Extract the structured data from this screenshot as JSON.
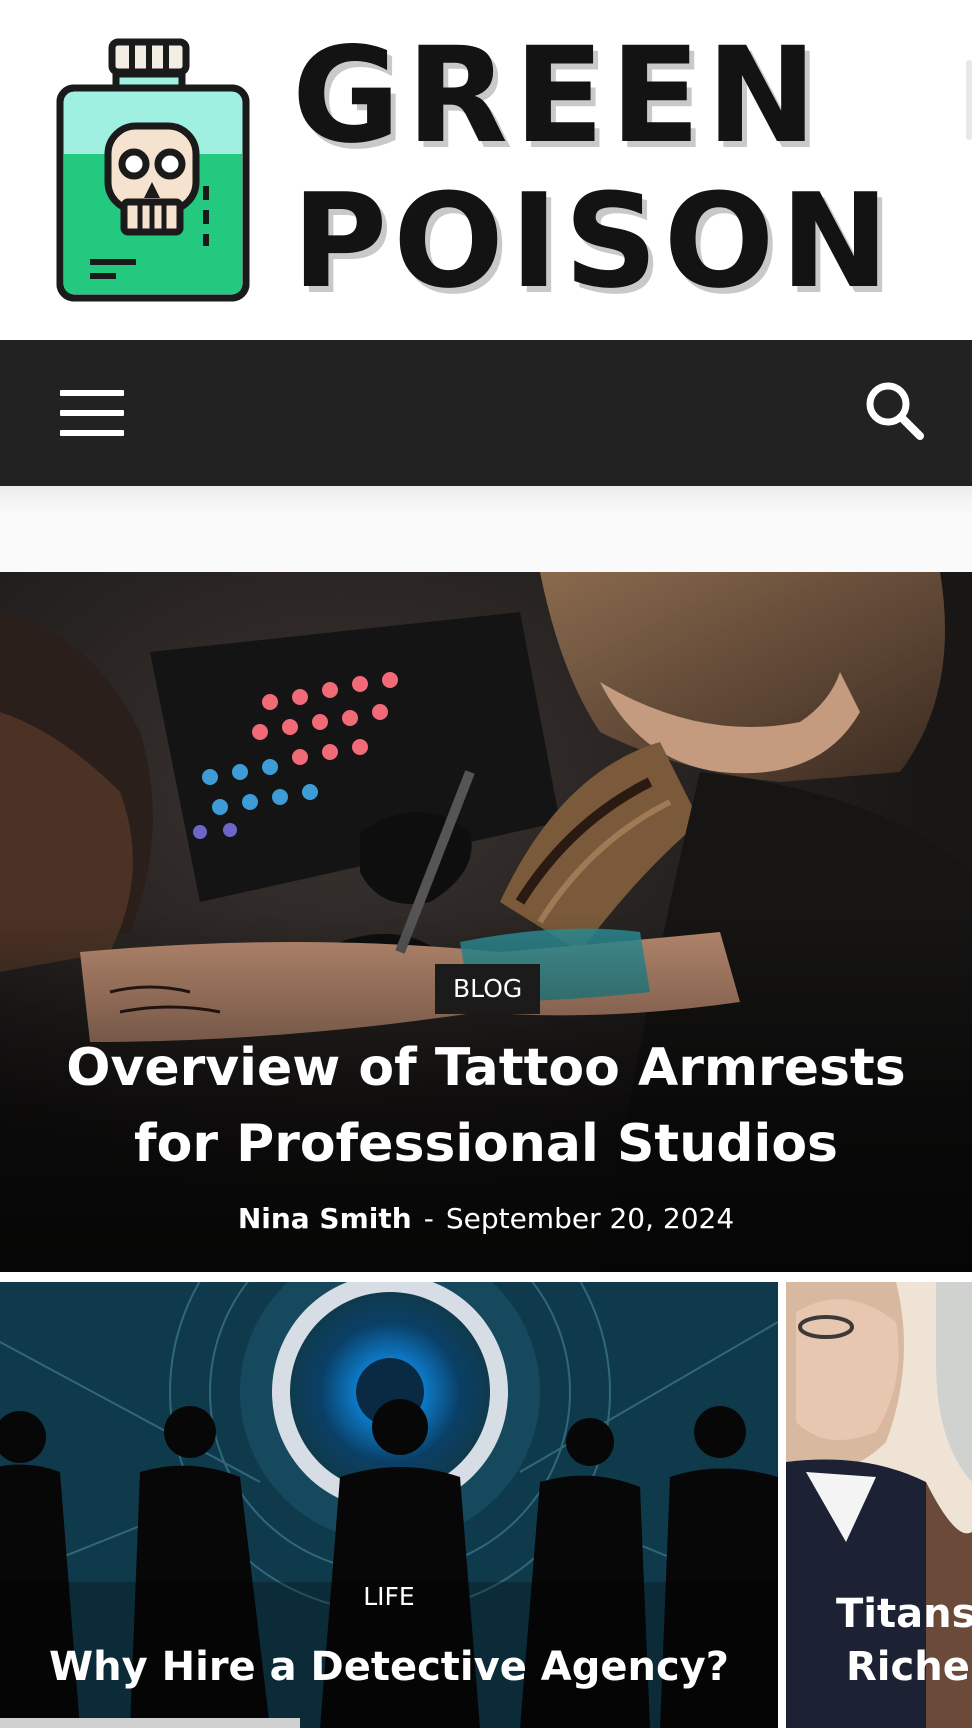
{
  "site": {
    "logo_line1": "GREEN",
    "logo_line2": "POISON",
    "logo_icon": "poison-bottle-skull-icon"
  },
  "navbar": {
    "menu_icon": "hamburger-menu-icon",
    "search_icon": "search-icon",
    "background": "#222222"
  },
  "featured": {
    "category": "BLOG",
    "title": "Overview of Tattoo Armrests for Professional Studios",
    "author": "Nina Smith",
    "separator": "-",
    "date": "September 20, 2024"
  },
  "tiles": [
    {
      "category": "LIFE",
      "title": "Why Hire a Detective Agency?"
    },
    {
      "title_line1": "Titans o",
      "title_line2": "Riches"
    }
  ],
  "colors": {
    "logo_teal": "#9ff0e0",
    "logo_green": "#22c97f",
    "logo_outline": "#1a1a1a",
    "category_bg": "#1b1b1b"
  }
}
